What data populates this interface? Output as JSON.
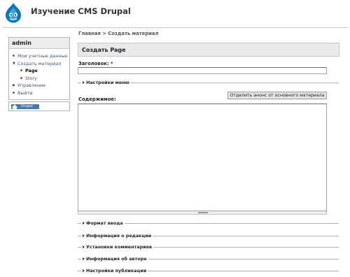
{
  "site": {
    "name": "Изучение CMS Drupal",
    "logo_icon": "drupal-drop-icon"
  },
  "sidebar": {
    "block_title": "admin",
    "items": [
      {
        "label": "Мои учетные данные",
        "type": "leaf"
      },
      {
        "label": "Создать материал",
        "type": "expanded"
      },
      {
        "label": "Page",
        "type": "sub",
        "active": true
      },
      {
        "label": "Story",
        "type": "sub"
      },
      {
        "label": "Управление",
        "type": "collapsed"
      },
      {
        "label": "Выйти",
        "type": "leaf"
      }
    ],
    "powered_by": "Drupal"
  },
  "breadcrumb": "Главная > Создать материал",
  "page": {
    "title": "Создать Page"
  },
  "form": {
    "title_label": "Заголовок:",
    "required_mark": "*",
    "title_value": "",
    "menu_settings": "Настройки меню",
    "split_summary_button": "Отделить анонс от основного материала",
    "body_label": "Содержимое:",
    "body_value": "",
    "fieldsets": [
      "Формат ввода",
      "Информация о редакции",
      "Установки комментариев",
      "Информация об авторе",
      "Настройки публикации"
    ]
  },
  "colors": {
    "link": "#3b5a7a",
    "required": "#cc0000",
    "badge": "#3a79ba"
  }
}
